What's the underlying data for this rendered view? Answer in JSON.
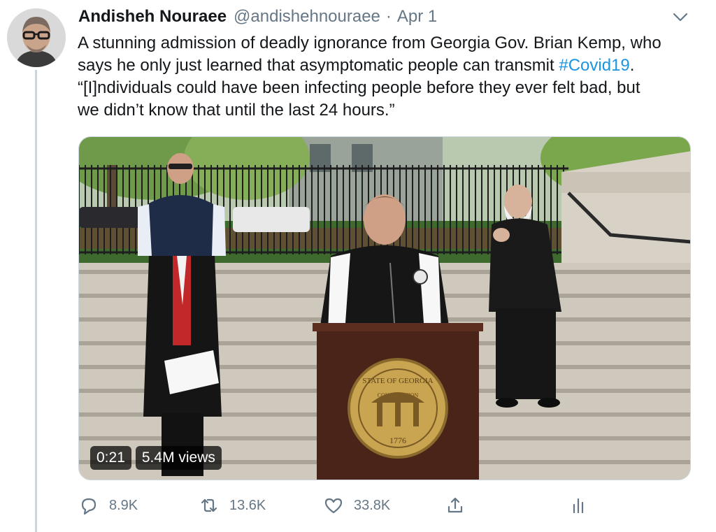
{
  "tweet": {
    "author_name": "Andisheh Nouraee",
    "handle": "@andishehnouraee",
    "separator": "·",
    "time": "Apr 1",
    "text_lines": [
      "A stunning admission of deadly ignorance from Georgia Gov. Brian Kemp, who",
      "says he only just learned that asymptomatic people can transmit ",
      "“[I]ndividuals could have been infecting people before they ever felt bad, but",
      "we didn’t know that until the last 24 hours.”"
    ],
    "hashtag": "#Covid19",
    "hashtag_suffix": "."
  },
  "video": {
    "duration": "0:21",
    "views": "5.4M views",
    "seal_text": "STATE OF GEORGIA",
    "seal_banner": "CONSTITUTION",
    "seal_year": "1776"
  },
  "actions": {
    "reply_count": "8.9K",
    "retweet_count": "13.6K",
    "like_count": "33.8K"
  },
  "colors": {
    "link": "#1b95e0",
    "secondary_text": "#657786",
    "thread_line": "#ccd6dd"
  },
  "icons": [
    "chevron-down-icon",
    "reply-icon",
    "retweet-icon",
    "like-icon",
    "share-icon",
    "analytics-icon"
  ]
}
